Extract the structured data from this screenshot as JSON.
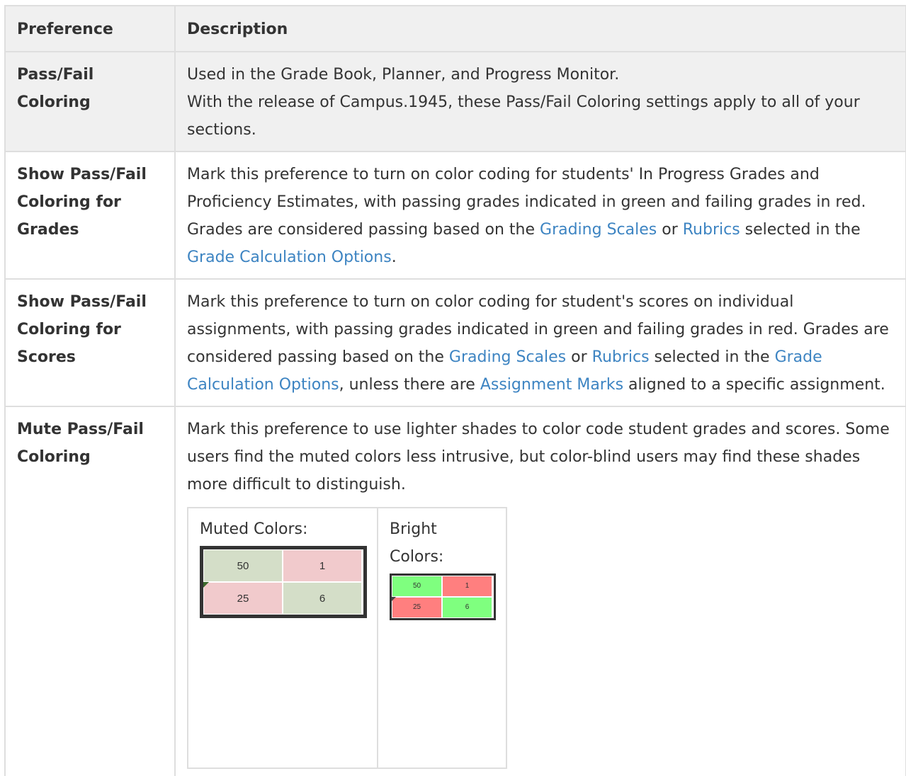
{
  "header": {
    "col1": "Preference",
    "col2": "Description"
  },
  "rows": [
    {
      "name": "Pass/Fail Coloring",
      "desc_lines": [
        "Used in the Grade Book, Planner, and Progress Monitor.",
        "With the release of Campus.1945, these Pass/Fail Coloring settings apply to all of your sections."
      ]
    },
    {
      "name": "Show Pass/Fail Coloring for Grades",
      "desc": {
        "t1": "Mark this preference to turn on color coding for students' In Progress Grades and Proficiency Estimates, with passing grades indicated in green and failing grades in red. Grades are considered passing based on the ",
        "l1": "Grading Scales",
        "t2": " or ",
        "l2": "Rubrics",
        "t3": " selected in the ",
        "l3": "Grade Calculation Options",
        "t4": "."
      }
    },
    {
      "name": "Show Pass/Fail Coloring for Scores",
      "desc": {
        "t1": "Mark this preference to turn on color coding for student's scores on individual assignments, with passing grades indicated in green and failing grades in red. Grades are considered passing based on the ",
        "l1": "Grading Scales",
        "t2": " or ",
        "l2": "Rubrics",
        "t3": " selected in the ",
        "l3": "Grade Calculation Options",
        "t4": ", unless there are ",
        "l4": "Assignment Marks",
        "t5": " aligned to a specific assignment."
      }
    },
    {
      "name": "Mute Pass/Fail Coloring",
      "desc": "Mark this preference to use lighter shades to color code student grades and scores. Some users find the muted colors less intrusive, but color-blind users may find these shades more difficult to distinguish.",
      "samples": {
        "muted": {
          "label": "Muted Colors:",
          "cells": [
            "50",
            "1",
            "25",
            "6"
          ],
          "pass_color": "#d4dec8",
          "fail_color": "#f1cacc"
        },
        "bright": {
          "label": "Bright Colors:",
          "cells": [
            "50",
            "1",
            "25",
            "6"
          ],
          "pass_color": "#7fff7f",
          "fail_color": "#ff7f7f"
        }
      }
    }
  ],
  "colors": {
    "link": "#3d84c2",
    "header_bg": "#f0f0f0",
    "border": "#dedede"
  }
}
